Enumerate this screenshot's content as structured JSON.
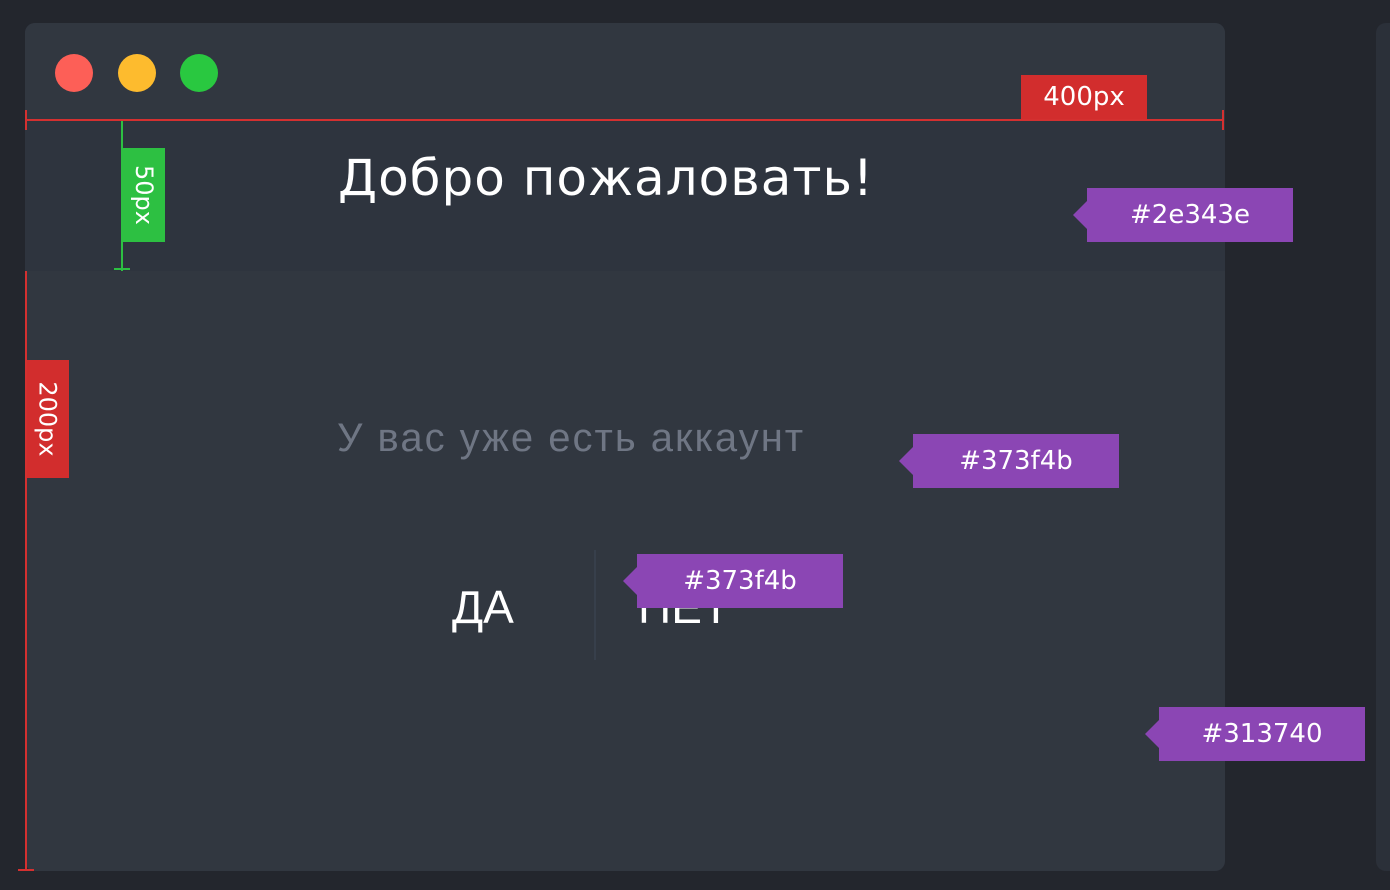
{
  "window": {
    "header_title": "Добро пожаловать!",
    "question": "У вас уже есть аккаунт",
    "answer_yes": "ДА",
    "answer_no": "НЕТ"
  },
  "annotations": {
    "width_label": "400px",
    "header_height_label": "50px",
    "body_height_label": "200px",
    "header_color_tag": "#2e343e",
    "question_color_tag": "#373f4b",
    "divider_color_tag": "#373f4b",
    "body_color_tag": "#313740"
  },
  "colors": {
    "header_bg": "#2e343e",
    "body_bg": "#313740",
    "divider": "#373f4b",
    "tag_bg": "#8b46b4",
    "dimension_red": "#d22d2d",
    "dimension_green": "#2dc042"
  }
}
